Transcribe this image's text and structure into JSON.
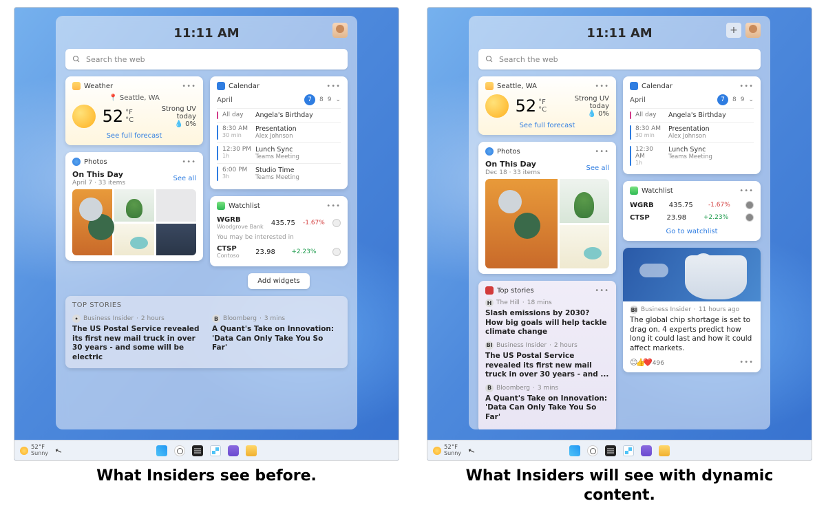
{
  "captions": {
    "left": "What Insiders see before.",
    "right": "What Insiders will see with dynamic content."
  },
  "common": {
    "time": "11:11 AM",
    "search_placeholder": "Search the web",
    "taskbar": {
      "temp": "52°F",
      "cond": "Sunny"
    }
  },
  "left": {
    "weather": {
      "title": "Weather",
      "location": "Seattle, WA",
      "temp": "52",
      "unit_top": "°F",
      "unit_bot": "°C",
      "cond": "Strong UV today",
      "precip": "0%",
      "link": "See full forecast"
    },
    "calendar": {
      "title": "Calendar",
      "month": "April",
      "selected_day": "7",
      "day2": "8",
      "day3": "9",
      "events": [
        {
          "time": "All day",
          "dur": "",
          "title": "Angela's Birthday",
          "sub": "",
          "color": "pink"
        },
        {
          "time": "8:30 AM",
          "dur": "30 min",
          "title": "Presentation",
          "sub": "Alex Johnson",
          "color": "blue"
        },
        {
          "time": "12:30 PM",
          "dur": "1h",
          "title": "Lunch Sync",
          "sub": "Teams Meeting",
          "color": "blue"
        },
        {
          "time": "6:00 PM",
          "dur": "3h",
          "title": "Studio Time",
          "sub": "Teams Meeting",
          "color": "blue"
        }
      ]
    },
    "photos": {
      "title": "Photos",
      "heading": "On This Day",
      "meta": "April 7 · 33 items",
      "see_all": "See all"
    },
    "watchlist": {
      "title": "Watchlist",
      "rows": [
        {
          "sym": "WGRB",
          "name": "Woodgrove Bank",
          "price": "435.75",
          "chg": "-1.67%",
          "dir": "down"
        },
        {
          "sym": "CTSP",
          "name": "Contoso",
          "price": "23.98",
          "chg": "+2.23%",
          "dir": "up"
        }
      ],
      "mid": "You may be interested in"
    },
    "add_widgets": "Add widgets",
    "top_stories": {
      "header": "TOP STORIES",
      "items": [
        {
          "src": "Business Insider",
          "time": "2 hours",
          "title": "The US Postal Service revealed its first new mail truck in over 30 years - and some will be electric"
        },
        {
          "src": "Bloomberg",
          "time": "3 mins",
          "glyph": "B",
          "title": "A Quant's Take on Innovation: 'Data Can Only Take You So Far'"
        }
      ]
    }
  },
  "right": {
    "weather": {
      "location": "Seattle, WA",
      "temp": "52",
      "unit_top": "°F",
      "unit_bot": "°C",
      "cond": "Strong UV today",
      "precip": "0%",
      "link": "See full forecast"
    },
    "calendar": {
      "title": "Calendar",
      "month": "April",
      "selected_day": "7",
      "day2": "8",
      "day3": "9",
      "events": [
        {
          "time": "All day",
          "dur": "",
          "title": "Angela's Birthday",
          "sub": "",
          "color": "pink"
        },
        {
          "time": "8:30 AM",
          "dur": "30 min",
          "title": "Presentation",
          "sub": "Alex Johnson",
          "color": "blue"
        },
        {
          "time": "12:30 AM",
          "dur": "1h",
          "title": "Lunch Sync",
          "sub": "Teams Meeting",
          "color": "blue"
        }
      ]
    },
    "photos": {
      "title": "Photos",
      "heading": "On This Day",
      "meta": "Dec 18 · 33 items",
      "see_all": "See all"
    },
    "watchlist": {
      "title": "Watchlist",
      "rows": [
        {
          "sym": "WGRB",
          "price": "435.75",
          "chg": "-1.67%",
          "dir": "down"
        },
        {
          "sym": "CTSP",
          "price": "23.98",
          "chg": "+2.23%",
          "dir": "up"
        }
      ],
      "link": "Go to watchlist"
    },
    "top_stories": {
      "title": "Top stories",
      "items": [
        {
          "glyph": "H",
          "src": "The Hill",
          "time": "18 mins",
          "title": "Slash emissions by 2030? How big goals will help tackle climate change"
        },
        {
          "glyph": "BI",
          "src": "Business Insider",
          "time": "2 hours",
          "title": "The US Postal Service revealed its first new mail truck in over 30 years - and ..."
        },
        {
          "glyph": "B",
          "src": "Bloomberg",
          "time": "3 mins",
          "title": "A Quant's Take on Innovation: 'Data Can Only Take You So Far'"
        }
      ]
    },
    "news_card": {
      "glyph": "BI",
      "src": "Business Insider",
      "time": "11 hours ago",
      "title": "The global chip shortage is set to drag on. 4 experts predict how long it could last and how it could affect markets.",
      "reactions": "496"
    }
  }
}
